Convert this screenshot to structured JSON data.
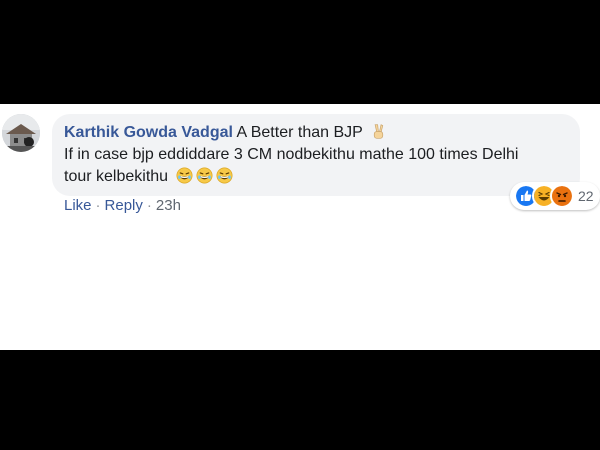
{
  "comment": {
    "author": "Karthik Gowda Vadgal",
    "text_line1": "A Better than BJP",
    "text_line2": "If in case bjp eddiddare 3 CM nodbekithu mathe 100 times Delhi",
    "text_line3": "tour kelbekithu",
    "inline_emojis": [
      "victory-hand-icon",
      "laughing-emoji",
      "laughing-emoji",
      "laughing-emoji"
    ]
  },
  "actions": {
    "like_label": "Like",
    "separator": "·",
    "reply_label": "Reply",
    "timestamp": "23h"
  },
  "reactions": {
    "types": [
      "like-icon",
      "haha-icon",
      "angry-icon"
    ],
    "count": "22"
  },
  "colors": {
    "author": "#385898",
    "bubble": "#f2f3f5",
    "like": "#1877f2",
    "haha": "#f7b125",
    "angry": "#e9710f"
  }
}
